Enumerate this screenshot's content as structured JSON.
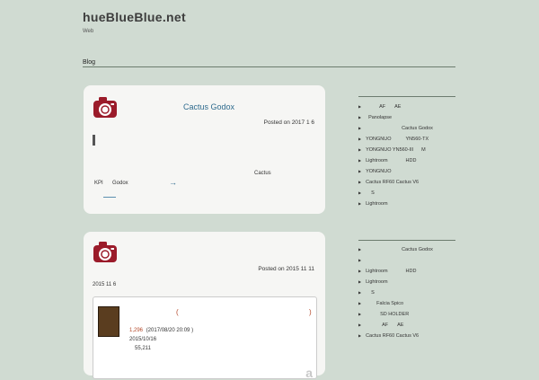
{
  "site": {
    "title": "hueBlueBlue.net",
    "tagline": "Web"
  },
  "nav": {
    "items": [
      "Blog"
    ]
  },
  "posts": [
    {
      "title": "Cactus Godox",
      "posted": "Posted on 2017 1 6",
      "text1": "Cactus",
      "text2a": "KPI",
      "text2b": "Godox",
      "arrow": "→"
    },
    {
      "posted": "Posted on 2015 11 11",
      "date_line": "2015 11 6",
      "paren_left": "(",
      "paren_right": ")",
      "rank": "1,296",
      "rank_time": "(2017/08/20 20:09 )",
      "release": "2015/10/16",
      "count": "55,211",
      "amazon": "a"
    }
  ],
  "sidebar": {
    "widget1": [
      [
        "AF",
        "AE"
      ],
      [
        "Panolapse"
      ],
      [
        "Cactus Godox"
      ],
      [
        "YONGNUO",
        "YN560-TX"
      ],
      [
        "YONGNUO YN560-III",
        "M"
      ],
      [
        "Lightroom",
        "HDD"
      ],
      [
        "YONGNUO"
      ],
      [
        "Cactus RF60 Cactus V6"
      ],
      [
        "S"
      ],
      [
        "Lightroom"
      ]
    ],
    "widget2": [
      [
        "Cactus Godox"
      ],
      [
        ""
      ],
      [
        "Lightroom",
        "HDD"
      ],
      [
        "Lightroom"
      ],
      [
        "S"
      ],
      [
        "Falcia Spico"
      ],
      [
        "SD HOLDER"
      ],
      [
        "AF",
        "AE"
      ],
      [
        "Cactus RF60 Cactus V6"
      ]
    ]
  },
  "colors": {
    "background": "#d0dbd2",
    "card": "#f6f6f4",
    "accent_red": "#9b1b2a",
    "link": "#2e6b8e"
  },
  "icons": {
    "post_icon": "camera-icon",
    "bullet": "triangle-right-icon"
  }
}
